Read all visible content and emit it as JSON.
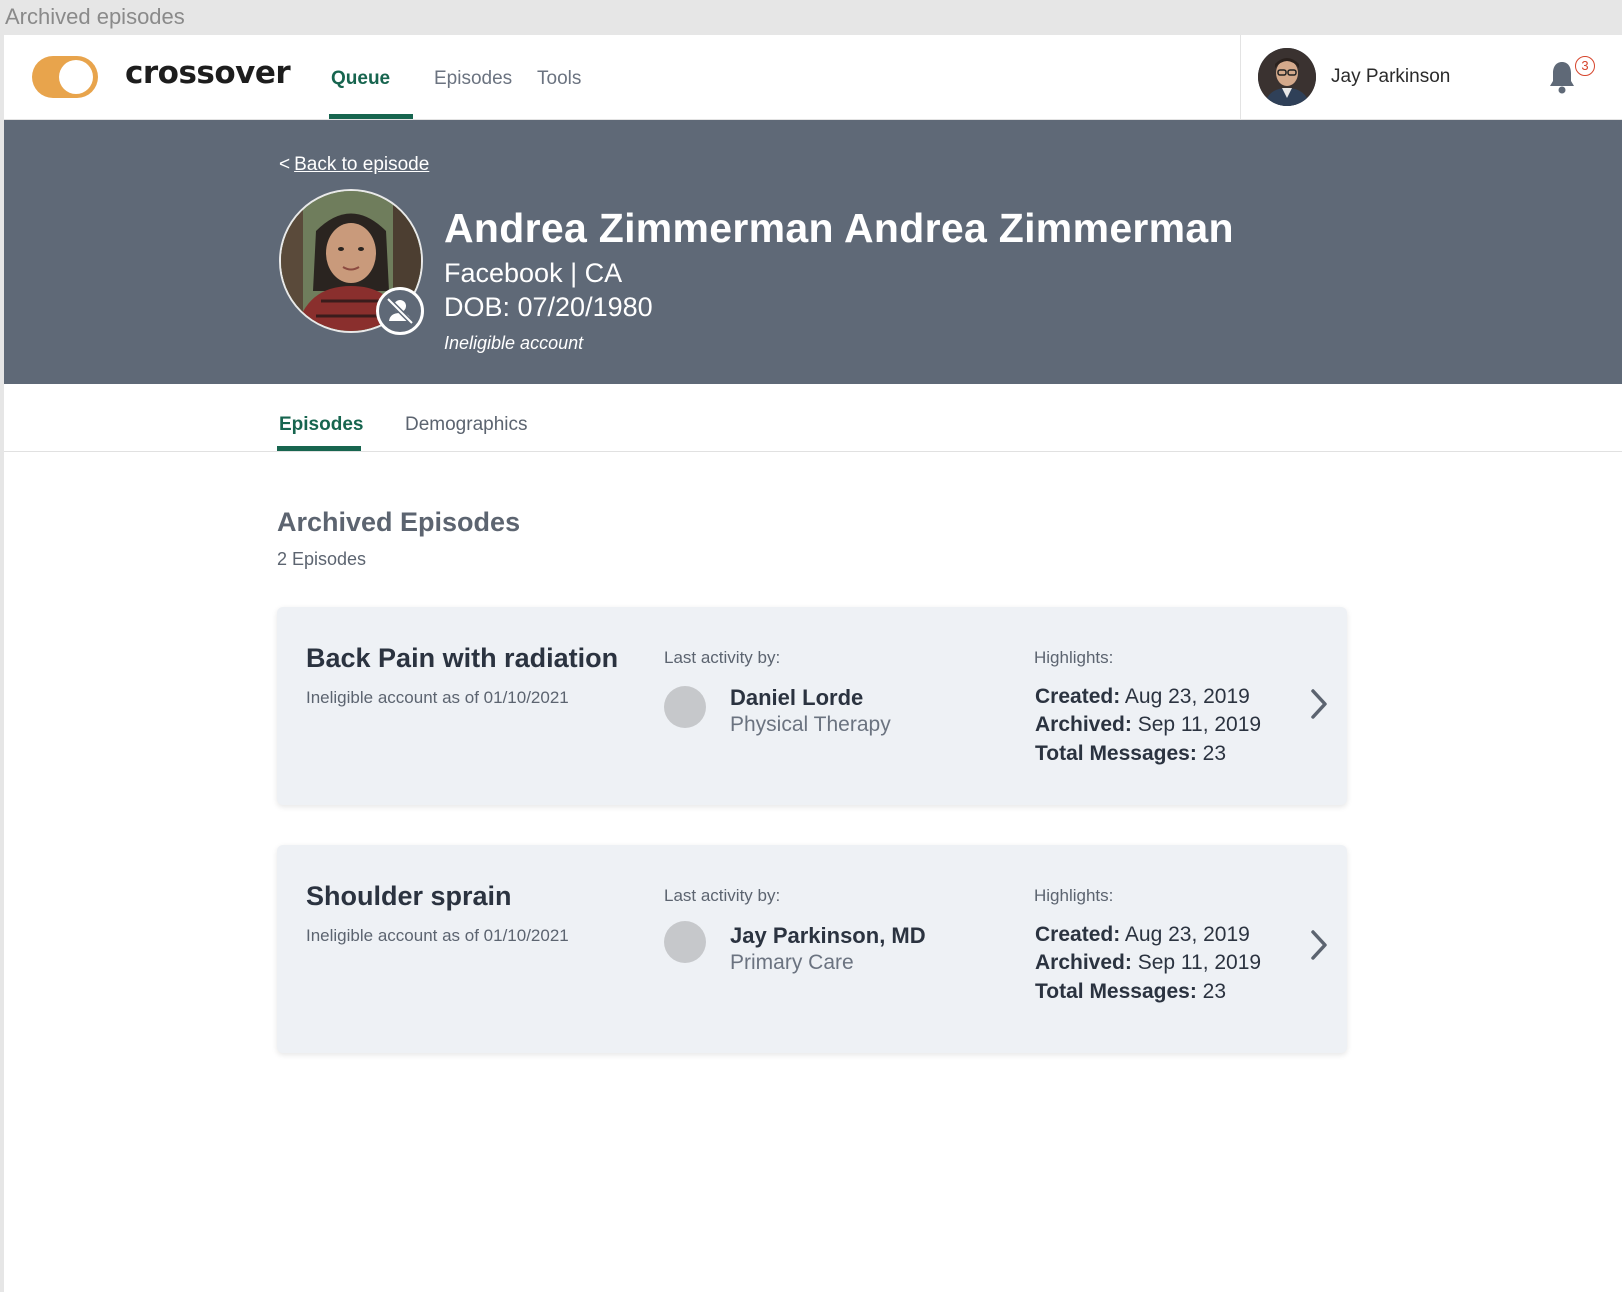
{
  "window": {
    "title": "Archived episodes"
  },
  "topbar": {
    "logo": "crossover",
    "nav": [
      {
        "label": "Queue",
        "active": true
      },
      {
        "label": "Episodes",
        "active": false
      },
      {
        "label": "Tools",
        "active": false
      }
    ],
    "user_name": "Jay Parkinson",
    "notification_count": "3"
  },
  "patient": {
    "back_link": "Back to episode",
    "back_chevron": "<",
    "name": "Andrea Zimmerman Andrea Zimmerman",
    "employer_state": "Facebook | CA",
    "dob": "DOB: 07/20/1980",
    "status": "Ineligible account"
  },
  "tabs": [
    {
      "label": "Episodes",
      "active": true
    },
    {
      "label": "Demographics",
      "active": false
    }
  ],
  "section": {
    "title": "Archived Episodes",
    "count": "2 Episodes"
  },
  "labels": {
    "last_activity": "Last activity by:",
    "highlights": "Highlights:",
    "created": "Created:",
    "archived": "Archived:",
    "total_messages": "Total Messages:"
  },
  "episodes": [
    {
      "title": "Back Pain with radiation",
      "subtitle": "Ineligible account as of 01/10/2021",
      "activity_name": "Daniel Lorde",
      "activity_role": "Physical Therapy",
      "created": "Aug 23, 2019",
      "archived": "Sep 11, 2019",
      "total_messages": "23"
    },
    {
      "title": "Shoulder sprain",
      "subtitle": "Ineligible account as of 01/10/2021",
      "activity_name": "Jay Parkinson, MD",
      "activity_role": "Primary Care",
      "created": "Aug 23, 2019",
      "archived": "Sep 11, 2019",
      "total_messages": "23"
    }
  ],
  "colors": {
    "accent": "#17654f",
    "toggle": "#e8a44c",
    "banner": "#5f6977",
    "card": "#eef1f5",
    "notification": "#d6452c"
  },
  "icons": {
    "bell": "bell-icon",
    "chevron": "chevron-right-icon",
    "ineligible": "user-slash-icon"
  }
}
